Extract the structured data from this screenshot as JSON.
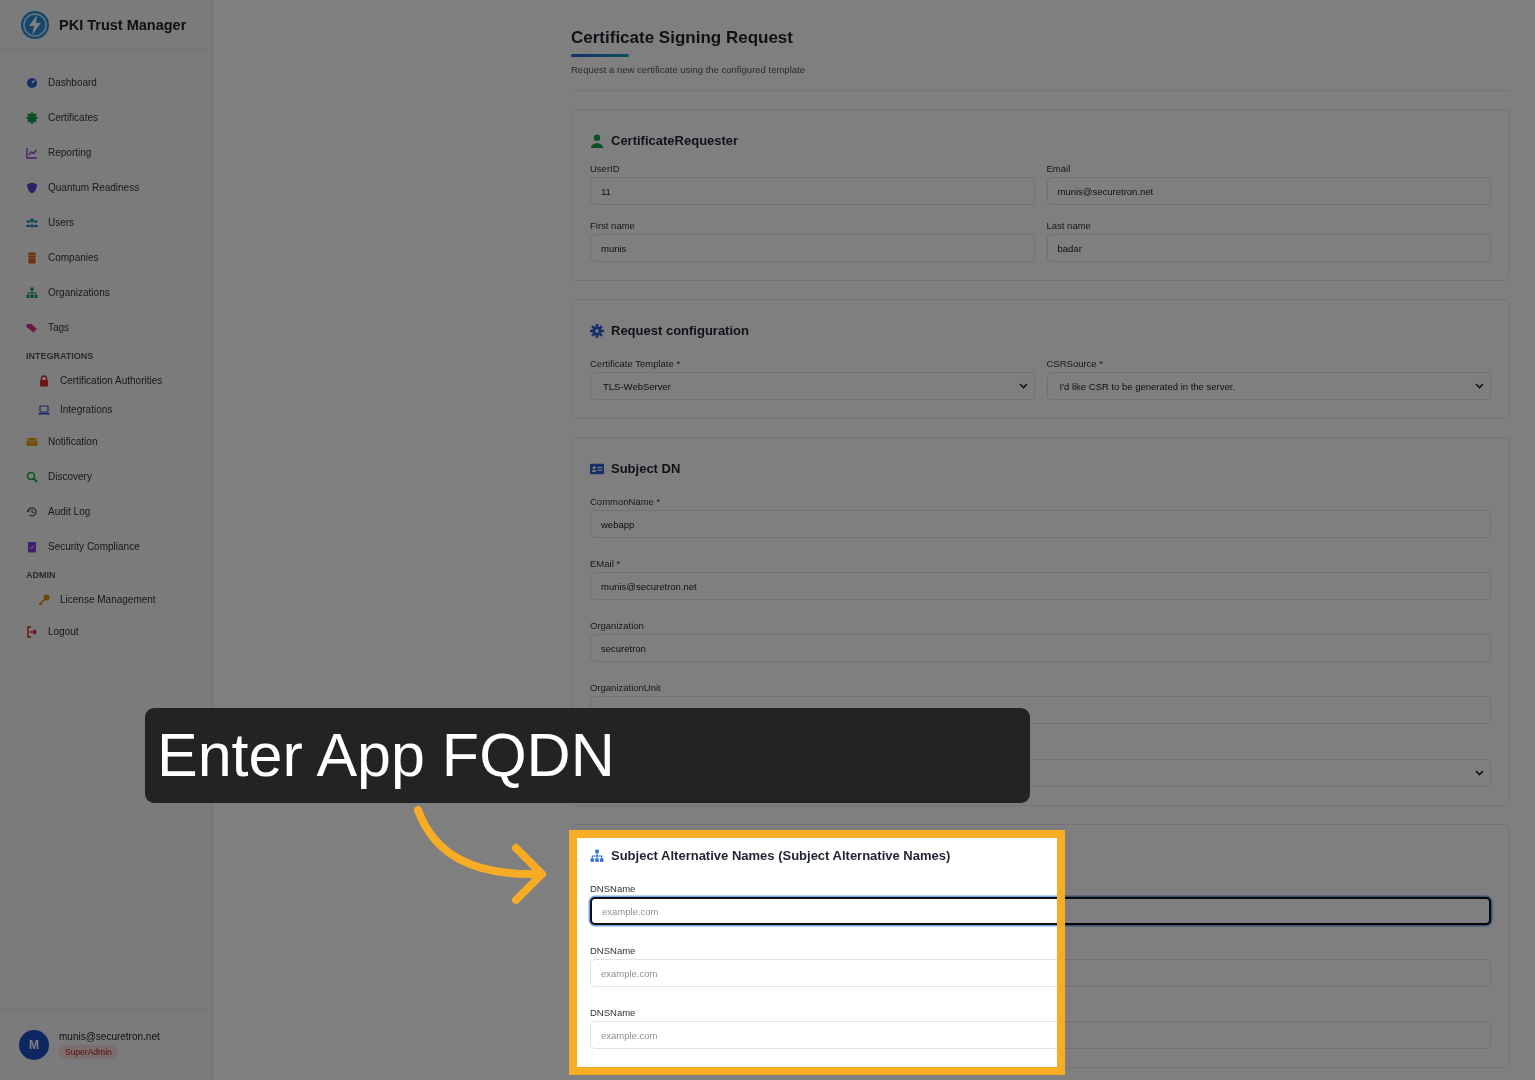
{
  "app": {
    "title": "PKI Trust Manager"
  },
  "sidebar": {
    "items": [
      {
        "kind": "item",
        "label": "Dashboard"
      },
      {
        "kind": "item",
        "label": "Certificates"
      },
      {
        "kind": "item",
        "label": "Reporting"
      },
      {
        "kind": "item",
        "label": "Quantum Readiness"
      },
      {
        "kind": "item",
        "label": "Users"
      },
      {
        "kind": "item",
        "label": "Companies"
      },
      {
        "kind": "item",
        "label": "Organizations"
      },
      {
        "kind": "item",
        "label": "Tags"
      },
      {
        "kind": "section",
        "label": "INTEGRATIONS"
      },
      {
        "kind": "subitem",
        "label": "Certification Authorities"
      },
      {
        "kind": "subitem",
        "label": "Integrations"
      },
      {
        "kind": "item",
        "label": "Notification"
      },
      {
        "kind": "item",
        "label": "Discovery"
      },
      {
        "kind": "item",
        "label": "Audit Log"
      },
      {
        "kind": "item",
        "label": "Security Compliance"
      },
      {
        "kind": "section",
        "label": "ADMIN"
      },
      {
        "kind": "subitem",
        "label": "License Management"
      },
      {
        "kind": "item",
        "label": "Logout"
      }
    ]
  },
  "user": {
    "initial": "M",
    "email": "munis@securetron.net",
    "role": "SuperAdmin"
  },
  "page": {
    "title": "Certificate Signing Request",
    "subtitle": "Request a new certificate using the configured template"
  },
  "cards": [
    {
      "title": "CertificateRequester",
      "kind": "two-column",
      "fields": [
        {
          "kind": "input",
          "label": "UserID",
          "value": "11"
        },
        {
          "kind": "input",
          "label": "Email",
          "value": "munis@securetron.net"
        },
        {
          "kind": "input",
          "label": "First name",
          "value": "munis"
        },
        {
          "kind": "input",
          "label": "Last name",
          "value": "badar"
        }
      ]
    },
    {
      "title": "Request configuration",
      "kind": "two-column",
      "fields": [
        {
          "kind": "select",
          "label": "Certificate Template *",
          "value": "TLS-WebServer"
        },
        {
          "kind": "select",
          "label": "CSRSource *",
          "value": "I'd like CSR to be generated in the server."
        }
      ]
    },
    {
      "title": "Subject DN",
      "kind": "single",
      "fields": [
        {
          "kind": "input",
          "label": "CommonName *",
          "value": "webapp"
        },
        {
          "kind": "input",
          "label": "EMail *",
          "value": "munis@securetron.net"
        },
        {
          "kind": "input",
          "label": "Organization",
          "value": "securetron"
        },
        {
          "kind": "input",
          "label": "OrganizationUnit"
        },
        {
          "kind": "select"
        }
      ]
    },
    {
      "title": "Subject Alternative Names (Subject Alternative Names)",
      "kind": "single",
      "fields": [
        {
          "kind": "input",
          "label": "DNSName",
          "placeholder": "example.com",
          "focused": true
        },
        {
          "kind": "input",
          "label": "DNSName",
          "placeholder": "example.com",
          "focused": false
        },
        {
          "kind": "input",
          "label": "DNSName",
          "placeholder": "example.com",
          "focused": false
        }
      ]
    }
  ],
  "callout": {
    "text": "Enter App FQDN"
  }
}
